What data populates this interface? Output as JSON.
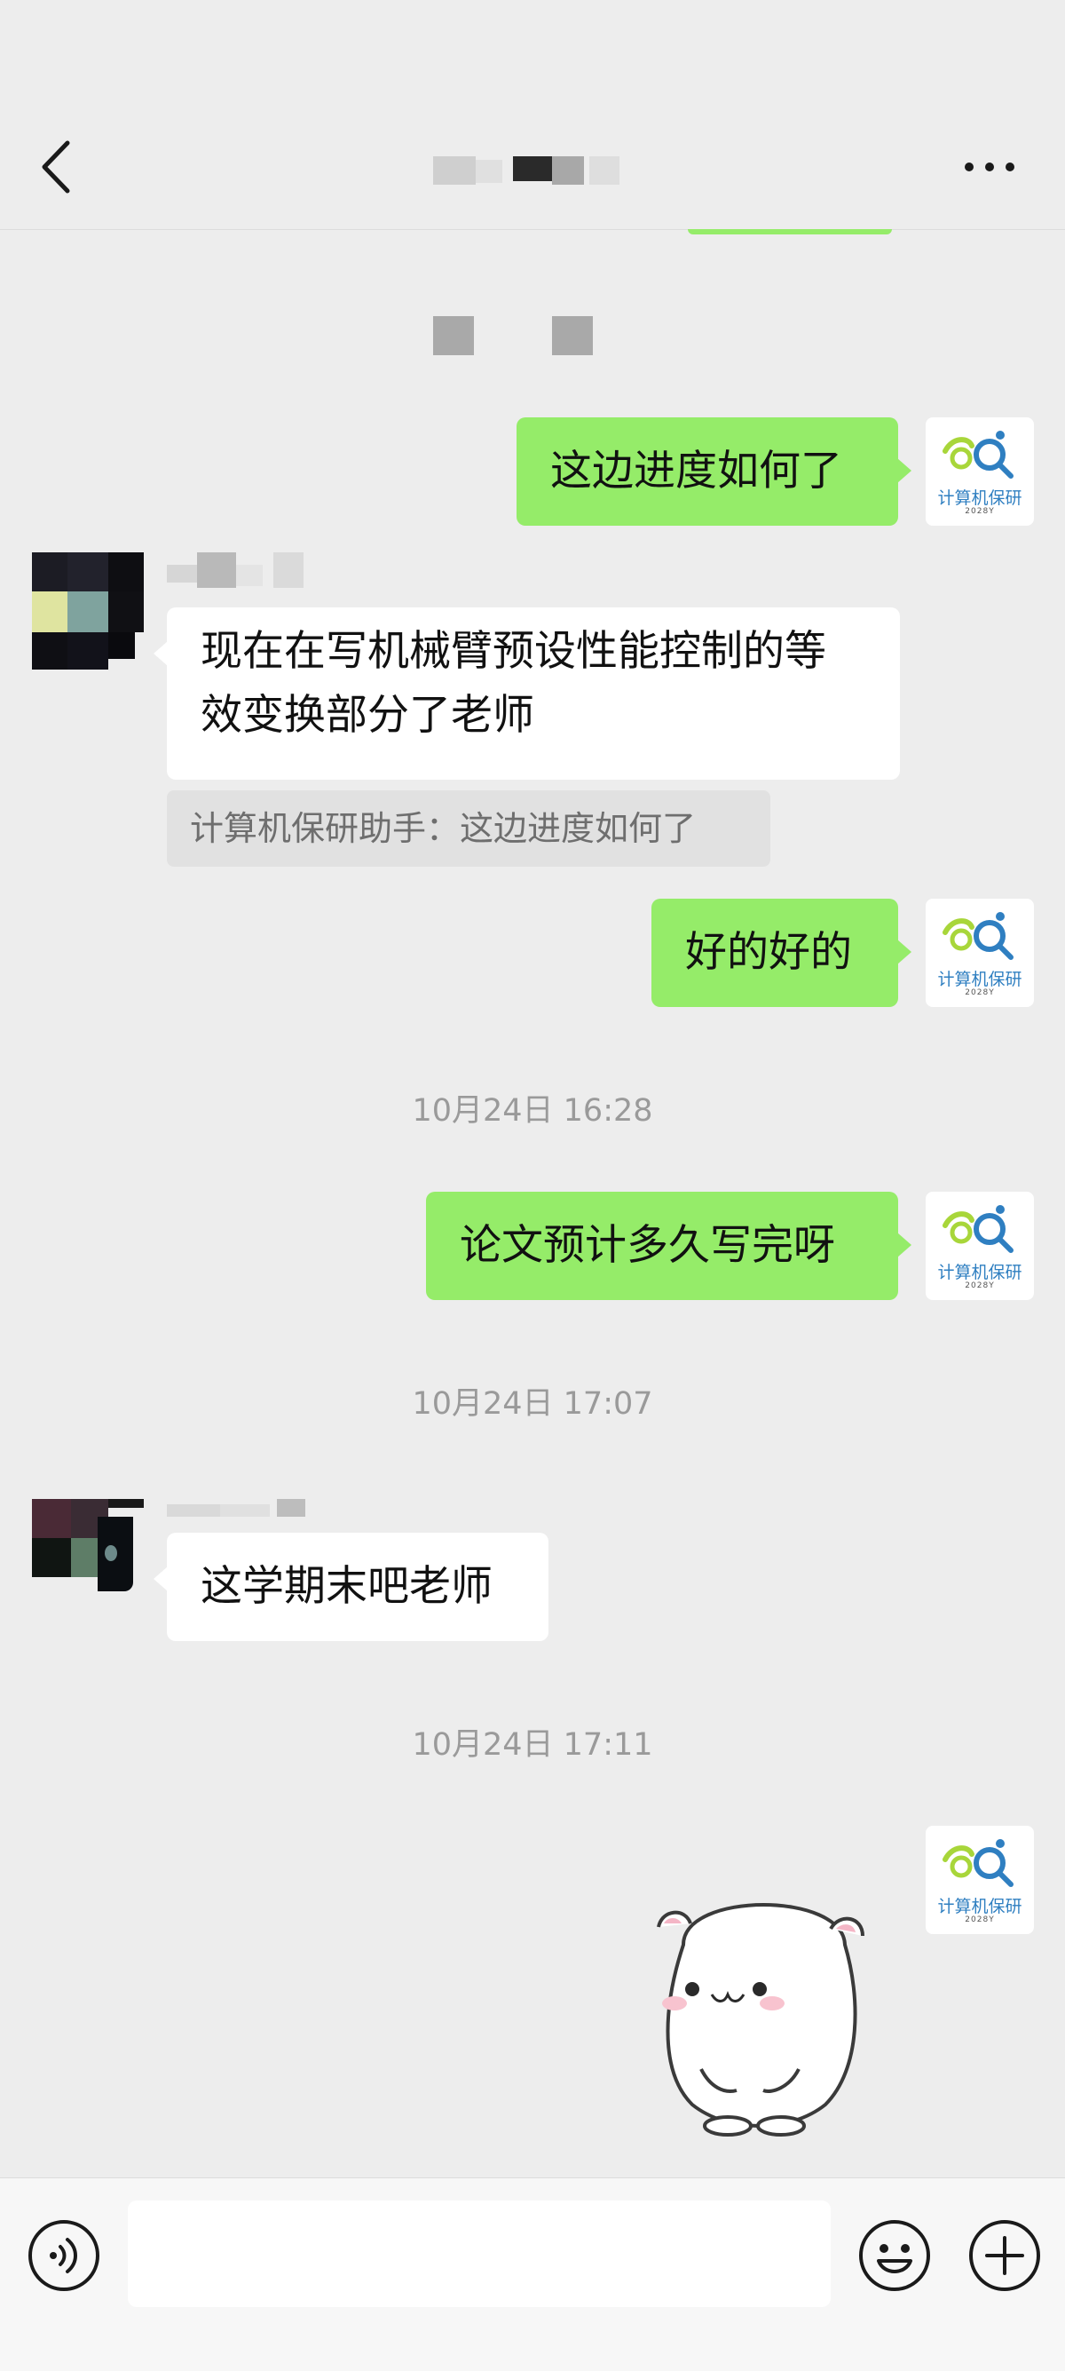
{
  "header": {
    "back_icon": "chevron-left-icon",
    "more_icon": "more-dots-icon"
  },
  "messages": {
    "me_1": "这边进度如何了",
    "other_1_line1": "现在在写机械臂预设性能控制的等",
    "other_1_line2": "效变换部分了老师",
    "quote": "计算机保研助手：这边进度如何了",
    "me_2": "好的好的",
    "time_1": "10月24日 16:28",
    "me_3": "论文预计多久写完呀",
    "time_2": "10月24日 17:07",
    "other_2": "这学期末吧老师",
    "time_3": "10月24日 17:11"
  },
  "my_avatar": {
    "logo_text": "计算机保研",
    "logo_sub": "2028Y"
  },
  "input_bar": {
    "voice_icon": "voice-icon",
    "emoji_icon": "smiley-icon",
    "plus_icon": "plus-icon",
    "value": ""
  },
  "colors": {
    "background": "#ededed",
    "my_bubble": "#95ec69",
    "their_bubble": "#ffffff",
    "timestamp": "#9a9a9a"
  }
}
